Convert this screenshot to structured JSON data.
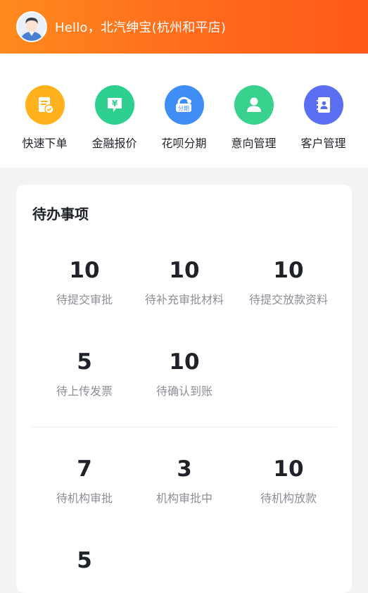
{
  "header": {
    "greeting": "Hello，北汽绅宝(杭州和平店)",
    "gradient": [
      "#ff8a1f",
      "#ff5a1a"
    ]
  },
  "quick_actions": [
    {
      "label": "快速下单",
      "icon": "order-doc-icon",
      "color": "#ffb21d"
    },
    {
      "label": "金融报价",
      "icon": "yuan-quote-icon",
      "color": "#2ed08f"
    },
    {
      "label": "花呗分期",
      "icon": "installment-icon",
      "color": "#3f8ef5"
    },
    {
      "label": "意向管理",
      "icon": "person-icon",
      "color": "#38d18d"
    },
    {
      "label": "客户管理",
      "icon": "contacts-book-icon",
      "color": "#5b6ff2"
    }
  ],
  "todo": {
    "title": "待办事项",
    "stats": [
      {
        "value": "10",
        "label": "待提交审批"
      },
      {
        "value": "10",
        "label": "待补充审批材料"
      },
      {
        "value": "10",
        "label": "待提交放款资料"
      },
      {
        "value": "5",
        "label": "待上传发票"
      },
      {
        "value": "10",
        "label": "待确认到账"
      },
      {
        "value": "7",
        "label": "待机构审批"
      },
      {
        "value": "3",
        "label": "机构审批中"
      },
      {
        "value": "10",
        "label": "待机构放款"
      },
      {
        "value": "5",
        "label": ""
      }
    ]
  }
}
